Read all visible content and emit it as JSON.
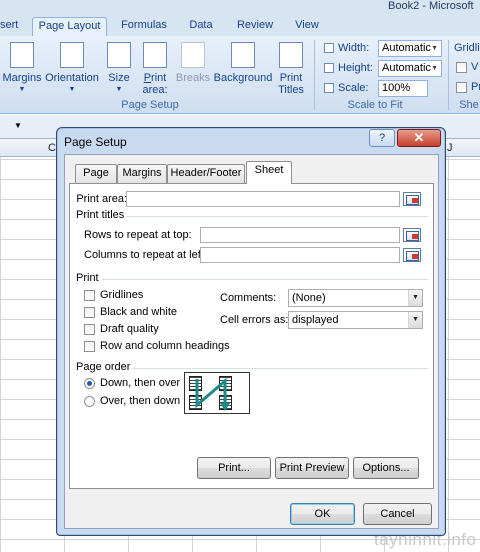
{
  "window": {
    "title": "Book2 - Microsoft"
  },
  "ribbon_tabs": [
    "sert",
    "Page Layout",
    "Formulas",
    "Data",
    "Review",
    "View"
  ],
  "ribbon": {
    "page_setup_buttons": [
      {
        "label": "Margins",
        "icon": "margins-icon"
      },
      {
        "label": "Orientation",
        "icon": "orientation-icon"
      },
      {
        "label": "Size",
        "icon": "size-icon"
      },
      {
        "label": "Print Area",
        "icon": "print-area-icon"
      },
      {
        "label": "Breaks",
        "icon": "breaks-icon",
        "disabled": true
      },
      {
        "label": "Background",
        "icon": "background-icon"
      },
      {
        "label": "Print Titles",
        "icon": "print-titles-icon"
      }
    ],
    "page_setup_group_label": "Page Setup",
    "scale_to_fit": {
      "width_label": "Width:",
      "width_value": "Automatic",
      "height_label": "Height:",
      "height_value": "Automatic",
      "scale_label": "Scale:",
      "scale_value": "100%",
      "group_label": "Scale to Fit"
    },
    "sheet_options": {
      "gridlines_label": "Gridli",
      "view_label": "V",
      "print_label": "Pr",
      "group_label": "She"
    }
  },
  "sheet": {
    "columns": [
      "C",
      "J"
    ]
  },
  "dialog": {
    "title": "Page Setup",
    "help_label": "?",
    "close_label": "✕",
    "tabs": [
      "Page",
      "Margins",
      "Header/Footer",
      "Sheet"
    ],
    "active_tab": "Sheet",
    "print_area_label": "Print area:",
    "print_area_value": "",
    "print_titles_label": "Print titles",
    "rows_repeat_label": "Rows to repeat at top:",
    "rows_repeat_value": "",
    "cols_repeat_label": "Columns to repeat at left:",
    "cols_repeat_value": "",
    "print_section_label": "Print",
    "checkboxes": [
      {
        "label": "Gridlines",
        "checked": false
      },
      {
        "label": "Black and white",
        "checked": false
      },
      {
        "label": "Draft quality",
        "checked": false
      },
      {
        "label": "Row and column headings",
        "checked": false
      }
    ],
    "comments_label": "Comments:",
    "comments_value": "(None)",
    "cell_errors_label": "Cell errors as:",
    "cell_errors_value": "displayed",
    "page_order_label": "Page order",
    "page_order_options": [
      {
        "label": "Down, then over",
        "selected": true
      },
      {
        "label": "Over, then down",
        "selected": false
      }
    ],
    "print_button": "Print...",
    "print_preview_button": "Print Preview",
    "options_button": "Options...",
    "ok_button": "OK",
    "cancel_button": "Cancel"
  },
  "watermark": "tayninhit.info",
  "colors": {
    "ribbon_text": "#15428b",
    "dialog_frame": "#c9daf0",
    "close_red": "#c7402c",
    "radio_dot": "#1e5bb8"
  }
}
